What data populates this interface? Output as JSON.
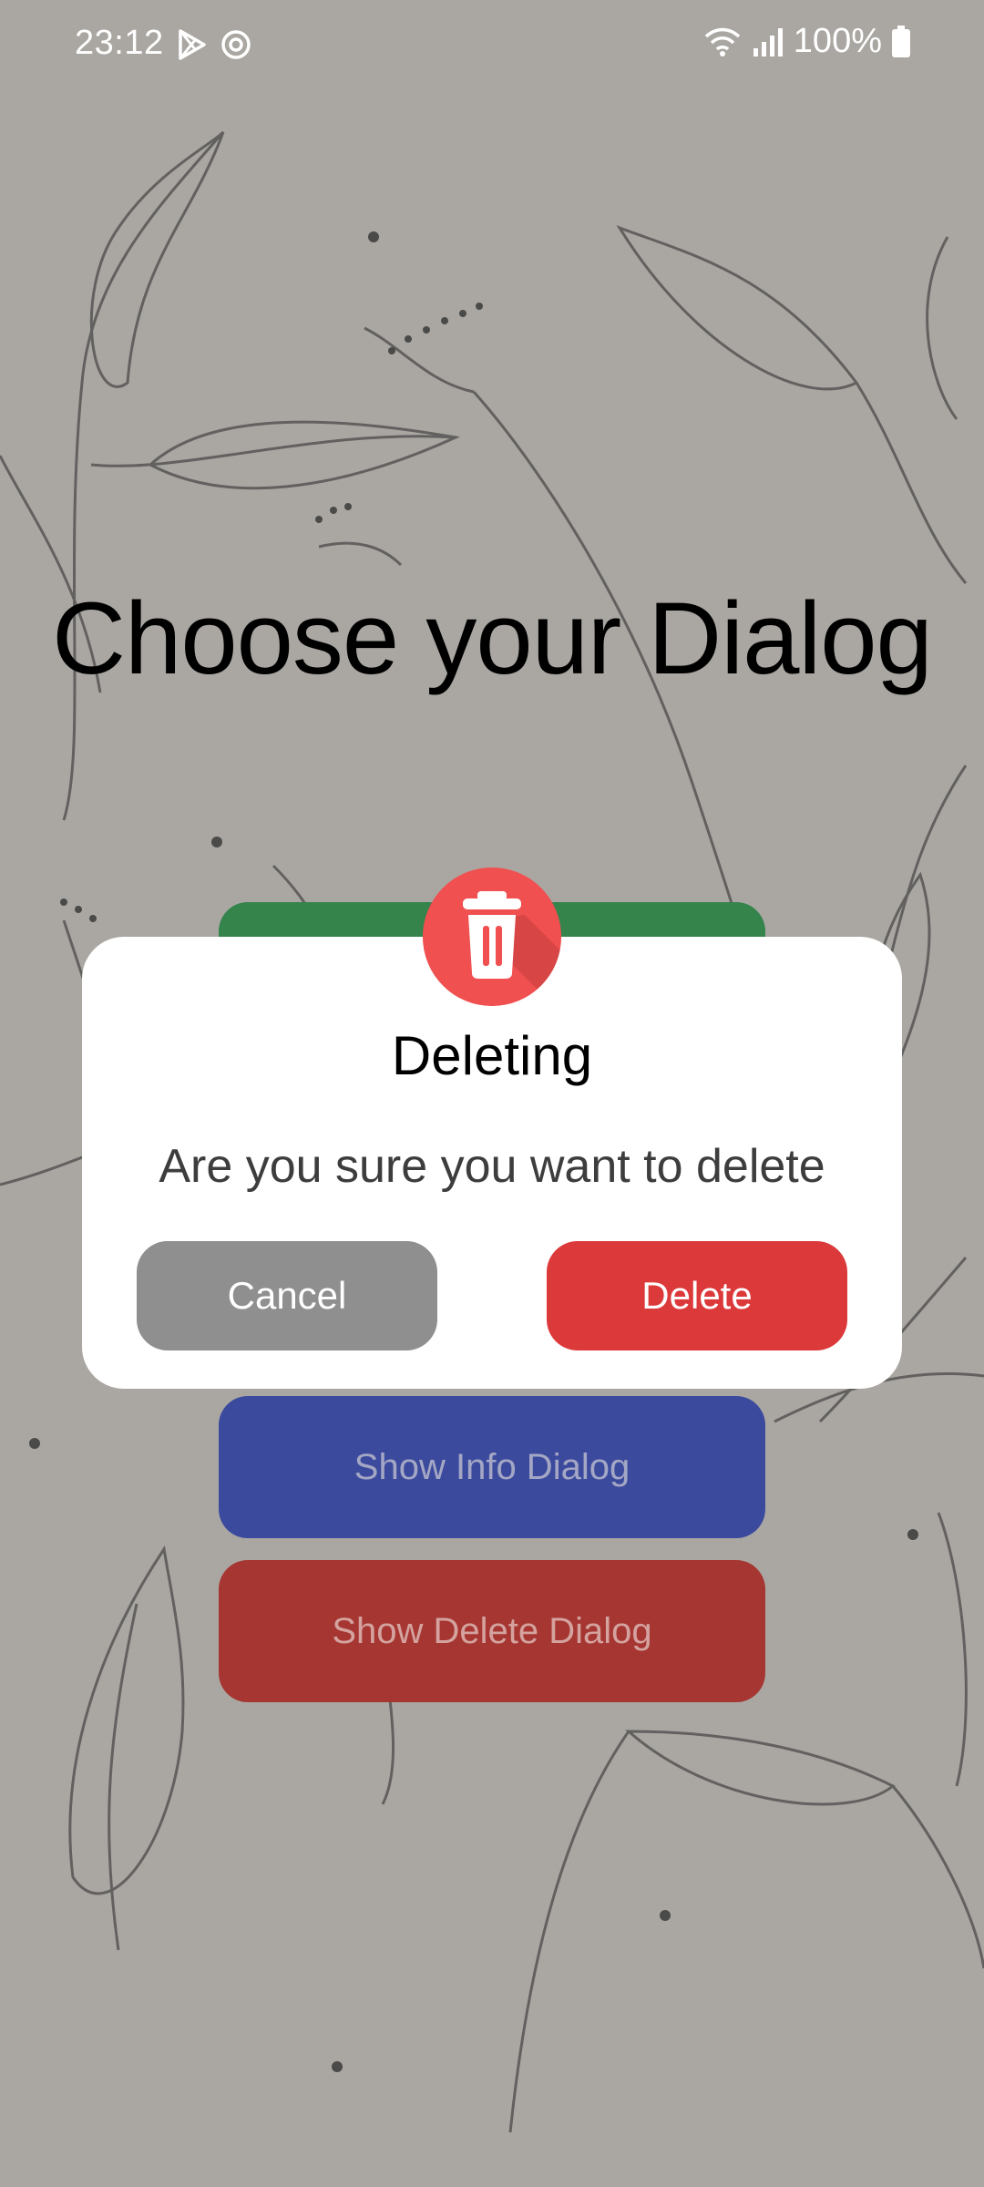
{
  "status_bar": {
    "time": "23:12",
    "battery": "100%",
    "icons": [
      "play-store-icon",
      "sync-icon",
      "wifi-icon",
      "signal-icon",
      "battery-icon"
    ]
  },
  "page": {
    "title": "Choose your Dialog"
  },
  "buttons": {
    "success_label": "",
    "info_label": "Show Info Dialog",
    "delete_label": "Show Delete Dialog"
  },
  "dialog": {
    "icon": "trash-icon",
    "title": "Deleting",
    "message": "Are you sure you want to delete",
    "cancel_label": "Cancel",
    "confirm_label": "Delete"
  },
  "colors": {
    "background": "#aaa7a2",
    "success_button": "#34844c",
    "info_button": "#3c4a9e",
    "delete_button": "#a63632",
    "dialog_cancel": "#8f8f8f",
    "dialog_delete": "#dc393b",
    "dialog_icon": "#f05050"
  }
}
